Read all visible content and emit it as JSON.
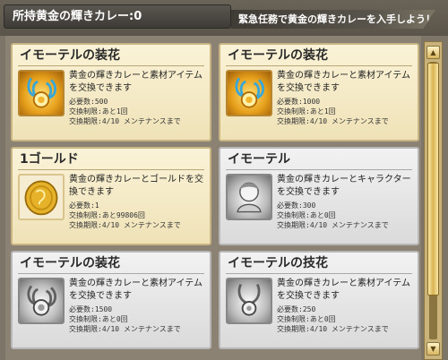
{
  "header": {
    "balance_label": "所持黄金の輝きカレー:0",
    "mission_text": "緊急任務で黄金の輝きカレーを入手しよう！"
  },
  "cards": [
    {
      "title": "イモーテルの装花",
      "desc": "黄金の輝きカレーと素材アイテムを交換できます",
      "required": "必要数:500",
      "limit": "交換制限:あと1回",
      "period": "交換期限:4/10 メンテナンスまで",
      "icon": "flower-ornament-icon",
      "state": "active"
    },
    {
      "title": "イモーテルの装花",
      "desc": "黄金の輝きカレーと素材アイテムを交換できます",
      "required": "必要数:1000",
      "limit": "交換制限:あと1回",
      "period": "交換期限:4/10 メンテナンスまで",
      "icon": "flower-ornament-icon",
      "state": "active"
    },
    {
      "title": "1ゴールド",
      "desc": "黄金の輝きカレーとゴールドを交換できます",
      "required": "必要数:1",
      "limit": "交換制限:あと99806回",
      "period": "交換期限:4/10 メンテナンスまで",
      "icon": "gold-coin-icon",
      "state": "active"
    },
    {
      "title": "イモーテル",
      "desc": "黄金の輝きカレーとキャラクターを交換できます",
      "required": "必要数:300",
      "limit": "交換制限:あと0回",
      "period": "交換期限:4/10 メンテナンスまで",
      "icon": "character-portrait-icon",
      "state": "disabled"
    },
    {
      "title": "イモーテルの装花",
      "desc": "黄金の輝きカレーと素材アイテムを交換できます",
      "required": "必要数:1500",
      "limit": "交換制限:あと0回",
      "period": "交換期限:4/10 メンテナンスまで",
      "icon": "flower-ornament-icon",
      "state": "disabled"
    },
    {
      "title": "イモーテルの技花",
      "desc": "黄金の輝きカレーと素材アイテムを交換できます",
      "required": "必要数:250",
      "limit": "交換制限:あと0回",
      "period": "交換期限:4/10 メンテナンスまで",
      "icon": "flower-ornament-icon",
      "state": "disabled"
    }
  ],
  "scrollbar": {
    "up_icon": "scroll-up-arrow-icon",
    "down_icon": "scroll-down-arrow-icon",
    "up_glyph": "▲",
    "down_glyph": "▼"
  }
}
